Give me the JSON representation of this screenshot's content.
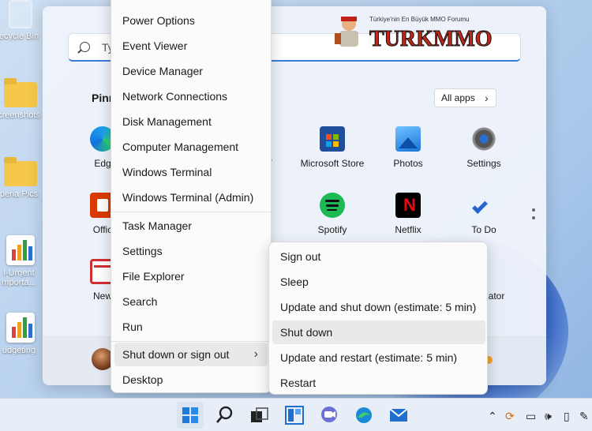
{
  "desktop": {
    "icons": [
      {
        "label": "ecycle Bin"
      },
      {
        "label": "creenshots"
      },
      {
        "label": "peria Pics"
      },
      {
        "label": "l-Urgent"
      },
      {
        "label": "mporta..."
      },
      {
        "label": "udgeting"
      }
    ]
  },
  "start_menu": {
    "search_text": "Ty",
    "banner_tagline": "Türkiye'nin En Büyük MMO Forumu",
    "banner_logo_text": "TURKMMO",
    "pinned_title": "Pinn",
    "all_apps_label": "All apps",
    "apps_row1": [
      {
        "label": "Edg",
        "icon": "edge-icon"
      },
      {
        "label": "Microsoft Store",
        "icon": "store-icon"
      },
      {
        "label": "Photos",
        "icon": "photos-icon"
      },
      {
        "label": "Settings",
        "icon": "settings-gear-icon"
      }
    ],
    "apps_row2": [
      {
        "label": "Offic",
        "icon": "office-icon"
      },
      {
        "label": "Spotify",
        "icon": "spotify-icon"
      },
      {
        "label": "Netflix",
        "icon": "netflix-icon"
      },
      {
        "label": "To Do",
        "icon": "todo-icon"
      }
    ],
    "apps_row3": [
      {
        "label": "New",
        "icon": "news-icon"
      },
      {
        "label": "ator",
        "icon": "calculator-icon"
      }
    ],
    "partial_r": "r"
  },
  "context_menu": {
    "items": [
      "Power Options",
      "Event Viewer",
      "Device Manager",
      "Network Connections",
      "Disk Management",
      "Computer Management",
      "Windows Terminal",
      "Windows Terminal (Admin)",
      "Task Manager",
      "Settings",
      "File Explorer",
      "Search",
      "Run",
      "Shut down or sign out",
      "Desktop"
    ]
  },
  "submenu": {
    "items": [
      "Sign out",
      "Sleep",
      "Update and shut down (estimate: 5 min)",
      "Shut down",
      "Update and restart (estimate: 5 min)",
      "Restart"
    ]
  },
  "taskbar": {
    "icons": [
      "windows-start-icon",
      "search-icon",
      "task-view-icon",
      "widgets-icon",
      "teams-chat-icon",
      "edge-icon",
      "mail-icon"
    ]
  },
  "colors": {
    "accent": "#3a7bd5",
    "netflix_red": "#e50914",
    "spotify_green": "#1db954"
  }
}
